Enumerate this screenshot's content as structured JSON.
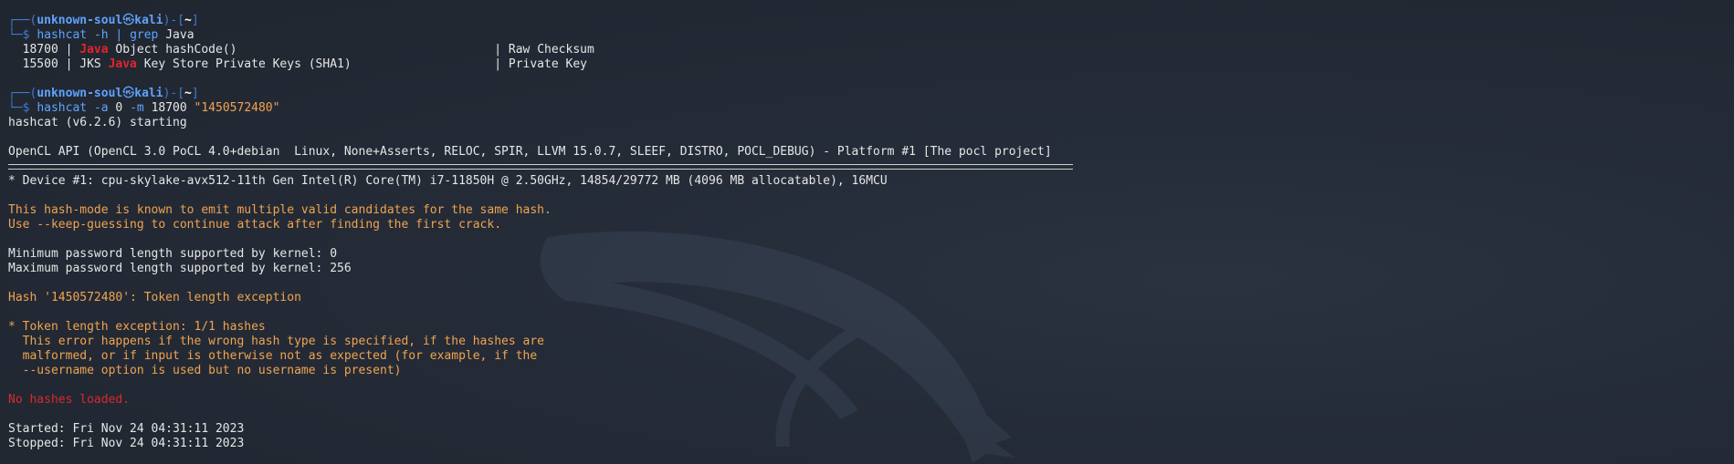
{
  "prompt1": {
    "user": "unknown-soul",
    "at_symbol": "㉿",
    "host": "kali",
    "dir": "~",
    "cmd": "hashcat",
    "flag": "-h",
    "pipe": "|",
    "grep": "grep",
    "arg": "Java"
  },
  "grep_results": [
    {
      "pre": "  18700 | ",
      "match": "Java",
      "post": " Object hashCode()                                    | Raw Checksum"
    },
    {
      "pre": "  15500 | JKS ",
      "match": "Java",
      "post": " Key Store Private Keys (SHA1)                    | Private Key"
    }
  ],
  "prompt2": {
    "user": "unknown-soul",
    "at_symbol": "㉿",
    "host": "kali",
    "dir": "~",
    "cmd": "hashcat",
    "flag_a": "-a",
    "val_a": "0",
    "flag_m": "-m",
    "val_m": "18700",
    "hash_arg": "\"1450572480\""
  },
  "output": {
    "starting": "hashcat (v6.2.6) starting",
    "opencl": "OpenCL API (OpenCL 3.0 PoCL 4.0+debian  Linux, None+Asserts, RELOC, SPIR, LLVM 15.0.7, SLEEF, DISTRO, POCL_DEBUG) - Platform #1 [The pocl project]",
    "device": "* Device #1: cpu-skylake-avx512-11th Gen Intel(R) Core(TM) i7-11850H @ 2.50GHz, 14854/29772 MB (4096 MB allocatable), 16MCU",
    "warn1": "This hash-mode is known to emit multiple valid candidates for the same hash.",
    "warn2": "Use --keep-guessing to continue attack after finding the first crack.",
    "minlen": "Minimum password length supported by kernel: 0",
    "maxlen": "Maximum password length supported by kernel: 256",
    "hash_exc": "Hash '1450572480': Token length exception",
    "tok1": "* Token length exception: 1/1 hashes",
    "tok2": "  This error happens if the wrong hash type is specified, if the hashes are",
    "tok3": "  malformed, or if input is otherwise not as expected (for example, if the",
    "tok4": "  --username option is used but no username is present)",
    "no_hashes": "No hashes loaded.",
    "started": "Started: Fri Nov 24 04:31:11 2023",
    "stopped": "Stopped: Fri Nov 24 04:31:11 2023"
  },
  "colors": {
    "background": "#232a36",
    "prompt_blue": "#5fa3ff",
    "warning_orange": "#f0a350",
    "error_red": "#d8282e",
    "match_red": "#e4232b"
  },
  "icons": {
    "watermark": "kali-dragon-icon"
  }
}
